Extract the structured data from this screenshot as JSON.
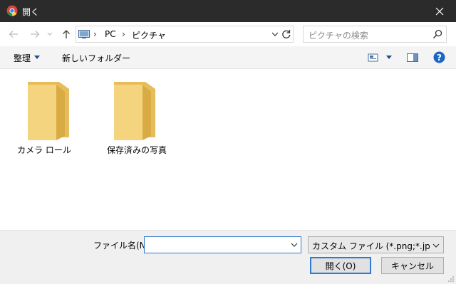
{
  "window": {
    "title": "開く",
    "close_icon": "close-icon"
  },
  "address": {
    "crumbs": [
      "PC",
      "ピクチャ"
    ],
    "search_placeholder": "ピクチャの検索"
  },
  "toolbar": {
    "organize_label": "整理",
    "new_folder_label": "新しいフォルダー"
  },
  "folders": [
    {
      "label": "カメラ ロール"
    },
    {
      "label": "保存済みの写真"
    }
  ],
  "bottom": {
    "filename_label": "ファイル名(N):",
    "filename_value": "",
    "filter_value": "カスタム ファイル (*.png;*.jpg;*.jpe",
    "open_label": "開く(O)",
    "cancel_label": "キャンセル"
  },
  "colors": {
    "titlebar": "#2b2b2b",
    "accent": "#2f7bd1",
    "help": "#1b65c4",
    "folder": "#f1cf72"
  }
}
